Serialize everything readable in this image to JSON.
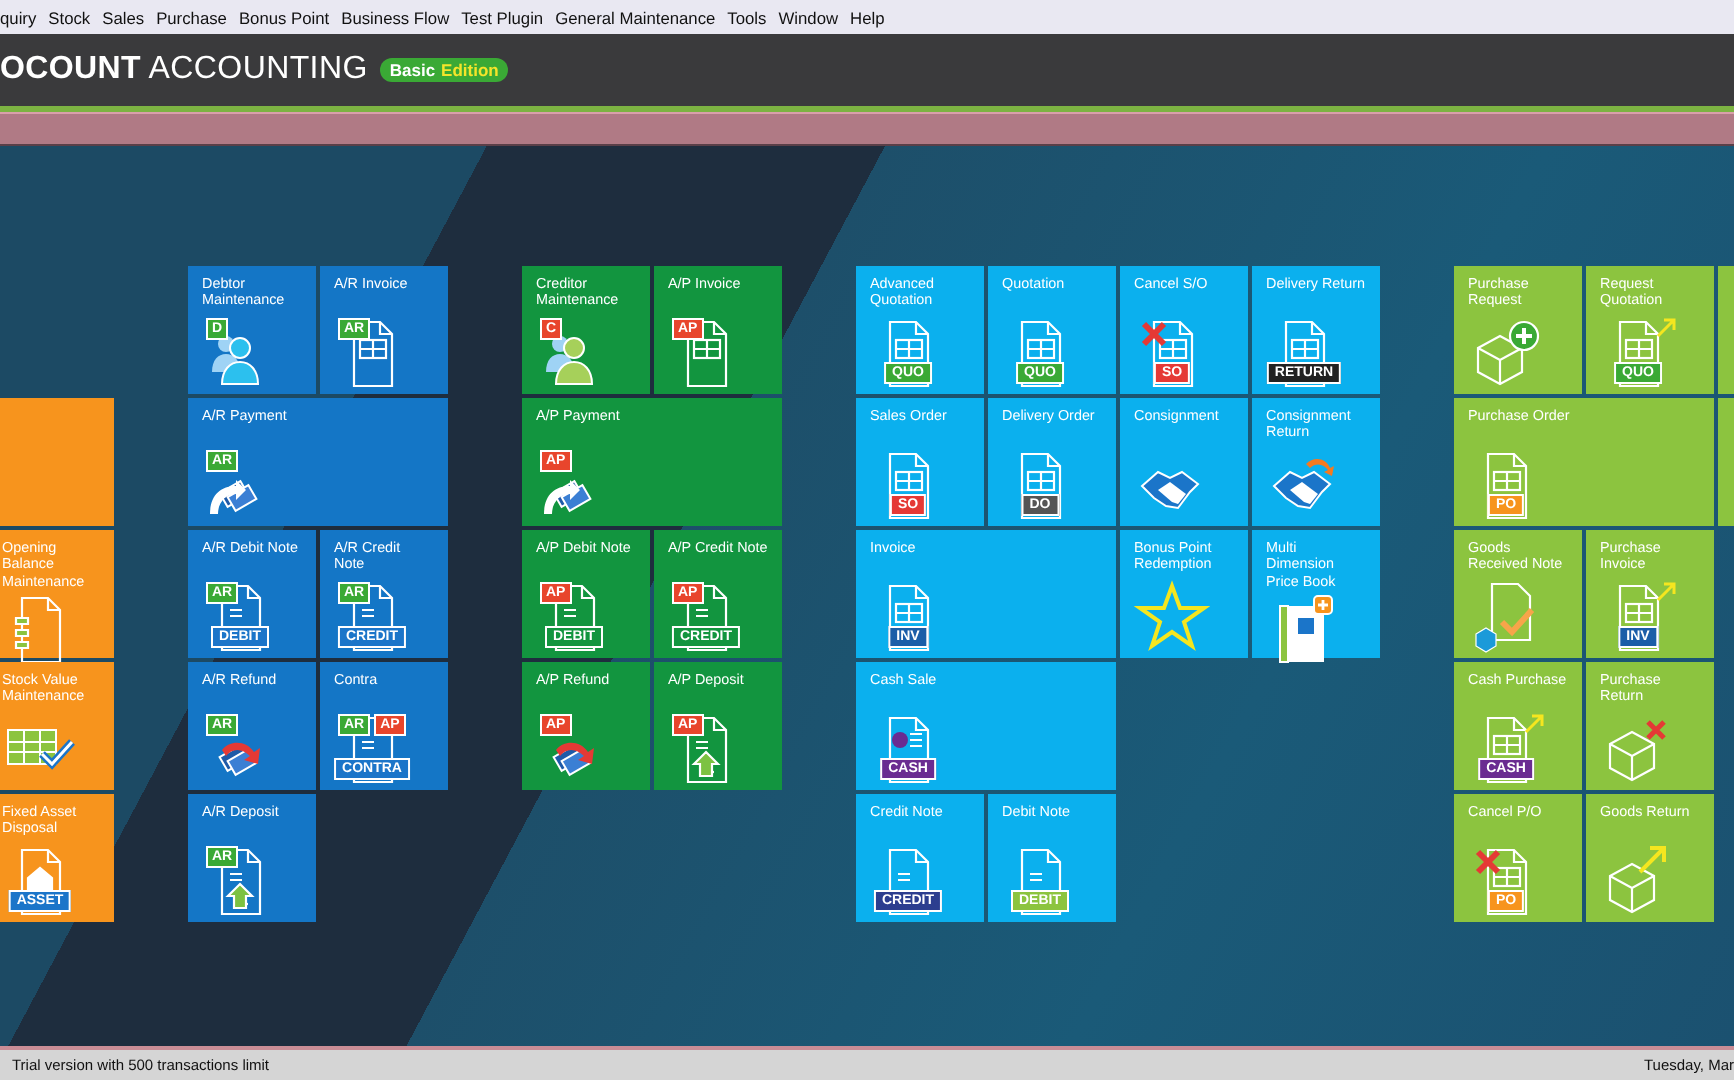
{
  "menu": [
    "quiry",
    "Stock",
    "Sales",
    "Purchase",
    "Bonus Point",
    "Business Flow",
    "Test Plugin",
    "General Maintenance",
    "Tools",
    "Window",
    "Help"
  ],
  "title": {
    "product": "**OCOUNT** ACCOUNTING",
    "edition": [
      {
        "text": "Basic",
        "color": "#ffffff"
      },
      {
        "text": "Edition",
        "color": "#f4e52a"
      }
    ]
  },
  "groups": [
    {
      "color": "#f7941d",
      "narrow": true,
      "blocks": [
        {
          "rows": [
            [],
            [
              {}
            ],
            [
              {
                "label": "Opening Balance Maintenance",
                "kind": "ledger"
              }
            ],
            [
              {
                "label": "Stock Value Maintenance",
                "kind": "sheet"
              }
            ],
            [
              {
                "label": "Fixed Asset Disposal",
                "kind": "asset",
                "stamp": {
                  "text": "ASSET",
                  "color": "#1b75c9"
                }
              }
            ]
          ]
        }
      ]
    },
    {
      "color": "#1476c6",
      "blocks": [
        {
          "rows": [
            [
              {
                "label": "Debtor Maintenance",
                "kind": "person",
                "tags": [
                  {
                    "text": "D",
                    "color": "#3aa935"
                  }
                ]
              },
              {
                "label": "A/R Invoice",
                "kind": "doc",
                "tags": [
                  {
                    "text": "AR",
                    "color": "#3aa935"
                  }
                ]
              }
            ],
            [
              {
                "label": "A/R Payment",
                "wide": true,
                "kind": "payment",
                "tags": [
                  {
                    "text": "AR",
                    "color": "#3aa935"
                  }
                ]
              }
            ],
            [
              {
                "label": "A/R Debit Note",
                "kind": "note",
                "tags": [
                  {
                    "text": "AR",
                    "color": "#3aa935"
                  }
                ],
                "stamp": {
                  "text": "DEBIT",
                  "color": "#1b75c9"
                }
              },
              {
                "label": "A/R Credit Note",
                "kind": "note",
                "tags": [
                  {
                    "text": "AR",
                    "color": "#3aa935"
                  }
                ],
                "stamp": {
                  "text": "CREDIT",
                  "color": "#1b75c9"
                }
              }
            ],
            [
              {
                "label": "A/R Refund",
                "kind": "refund",
                "tags": [
                  {
                    "text": "AR",
                    "color": "#3aa935"
                  }
                ]
              },
              {
                "label": "Contra",
                "kind": "note",
                "tags": [
                  {
                    "text": "AR",
                    "color": "#3aa935"
                  },
                  {
                    "text": "AP",
                    "color": "#e8452c"
                  }
                ],
                "stamp": {
                  "text": "CONTRA",
                  "color": "#1b75c9"
                }
              }
            ],
            [
              {
                "label": "A/R Deposit",
                "kind": "deposit",
                "tags": [
                  {
                    "text": "AR",
                    "color": "#3aa935"
                  }
                ]
              }
            ]
          ]
        }
      ]
    },
    {
      "color": "#12953f",
      "blocks": [
        {
          "rows": [
            [
              {
                "label": "Creditor Maintenance",
                "kind": "person",
                "tags": [
                  {
                    "text": "C",
                    "color": "#e8452c"
                  }
                ]
              },
              {
                "label": "A/P Invoice",
                "kind": "doc",
                "tags": [
                  {
                    "text": "AP",
                    "color": "#e8452c"
                  }
                ]
              }
            ],
            [
              {
                "label": "A/P Payment",
                "wide": true,
                "kind": "payment",
                "tags": [
                  {
                    "text": "AP",
                    "color": "#e8452c"
                  }
                ]
              }
            ],
            [
              {
                "label": "A/P Debit Note",
                "kind": "note",
                "tags": [
                  {
                    "text": "AP",
                    "color": "#e8452c"
                  }
                ],
                "stamp": {
                  "text": "DEBIT",
                  "color": "#12953f"
                }
              },
              {
                "label": "A/P Credit Note",
                "kind": "note",
                "tags": [
                  {
                    "text": "AP",
                    "color": "#e8452c"
                  }
                ],
                "stamp": {
                  "text": "CREDIT",
                  "color": "#12953f"
                }
              }
            ],
            [
              {
                "label": "A/P Refund",
                "kind": "refund",
                "tags": [
                  {
                    "text": "AP",
                    "color": "#e8452c"
                  }
                ]
              },
              {
                "label": "A/P Deposit",
                "kind": "deposit",
                "tags": [
                  {
                    "text": "AP",
                    "color": "#e8452c"
                  }
                ]
              }
            ]
          ]
        }
      ]
    },
    {
      "color": "#0bb0ee",
      "blocks": [
        {
          "rows": [
            [
              {
                "label": "Advanced Quotation",
                "kind": "doc",
                "stamp": {
                  "text": "QUO",
                  "color": "#3aa935"
                }
              },
              {
                "label": "Quotation",
                "kind": "doc",
                "stamp": {
                  "text": "QUO",
                  "color": "#3aa935"
                }
              }
            ],
            [
              {
                "label": "Sales Order",
                "kind": "doc",
                "stamp": {
                  "text": "SO",
                  "color": "#e53935"
                }
              },
              {
                "label": "Delivery Order",
                "kind": "doc",
                "stamp": {
                  "text": "DO",
                  "color": "#555555"
                }
              }
            ],
            [
              {
                "label": "Invoice",
                "wide": true,
                "kind": "doc",
                "stamp": {
                  "text": "INV",
                  "color": "#1b5ea8"
                }
              }
            ],
            [
              {
                "label": "Cash Sale",
                "wide": true,
                "kind": "cash",
                "stamp": {
                  "text": "CASH",
                  "color": "#6a2c91"
                }
              }
            ],
            [
              {
                "label": "Credit Note",
                "kind": "note",
                "stamp": {
                  "text": "CREDIT",
                  "color": "#2c3e8f"
                }
              },
              {
                "label": "Debit Note",
                "kind": "note",
                "stamp": {
                  "text": "DEBIT",
                  "color": "#8cc43f"
                }
              }
            ]
          ]
        },
        {
          "rows": [
            [
              {
                "label": "Cancel S/O",
                "kind": "doc",
                "cancelled": true,
                "stamp": {
                  "text": "SO",
                  "color": "#e53935"
                }
              },
              {
                "label": "Delivery Return",
                "kind": "doc",
                "stamp": {
                  "text": "RETURN",
                  "color": "#222222"
                }
              }
            ],
            [
              {
                "label": "Consignment",
                "kind": "handshake"
              },
              {
                "label": "Consignment Return",
                "kind": "handshake",
                "corner_arrow": true
              }
            ],
            [
              {
                "label": "Bonus Point Redemption",
                "kind": "star"
              },
              {
                "label": "Multi Dimension Price Book",
                "kind": "book"
              }
            ]
          ]
        }
      ]
    },
    {
      "color": "#8cc43f",
      "blocks": [
        {
          "rows": [
            [
              {
                "label": "Purchase Request",
                "kind": "boxplus"
              },
              {
                "label": "Request Quotation",
                "kind": "doc",
                "corner_arrow": true,
                "stamp": {
                  "text": "QUO",
                  "color": "#3aa935"
                }
              }
            ],
            [
              {
                "label": "Purchase Order",
                "wide": true,
                "kind": "doc",
                "stamp": {
                  "text": "PO",
                  "color": "#f7941d"
                }
              }
            ],
            [
              {
                "label": "Goods Received Note",
                "kind": "grn"
              },
              {
                "label": "Purchase Invoice",
                "kind": "doc",
                "corner_arrow": true,
                "stamp": {
                  "text": "INV",
                  "color": "#1b5ea8"
                }
              }
            ],
            [
              {
                "label": "Cash Purchase",
                "kind": "doc",
                "corner_arrow": true,
                "stamp": {
                  "text": "CASH",
                  "color": "#6a2c91"
                }
              },
              {
                "label": "Purchase Return",
                "kind": "boxcross"
              }
            ],
            [
              {
                "label": "Cancel P/O",
                "kind": "doc",
                "cancelled": true,
                "stamp": {
                  "text": "PO",
                  "color": "#f7941d"
                }
              },
              {
                "label": "Goods Return",
                "kind": "boxarrow"
              }
            ]
          ]
        },
        {
          "rows": [
            [
              {}
            ],
            [
              {}
            ]
          ]
        }
      ]
    }
  ],
  "status": {
    "left": "Trial version with 500 transactions limit",
    "right": "Tuesday, Mar"
  }
}
